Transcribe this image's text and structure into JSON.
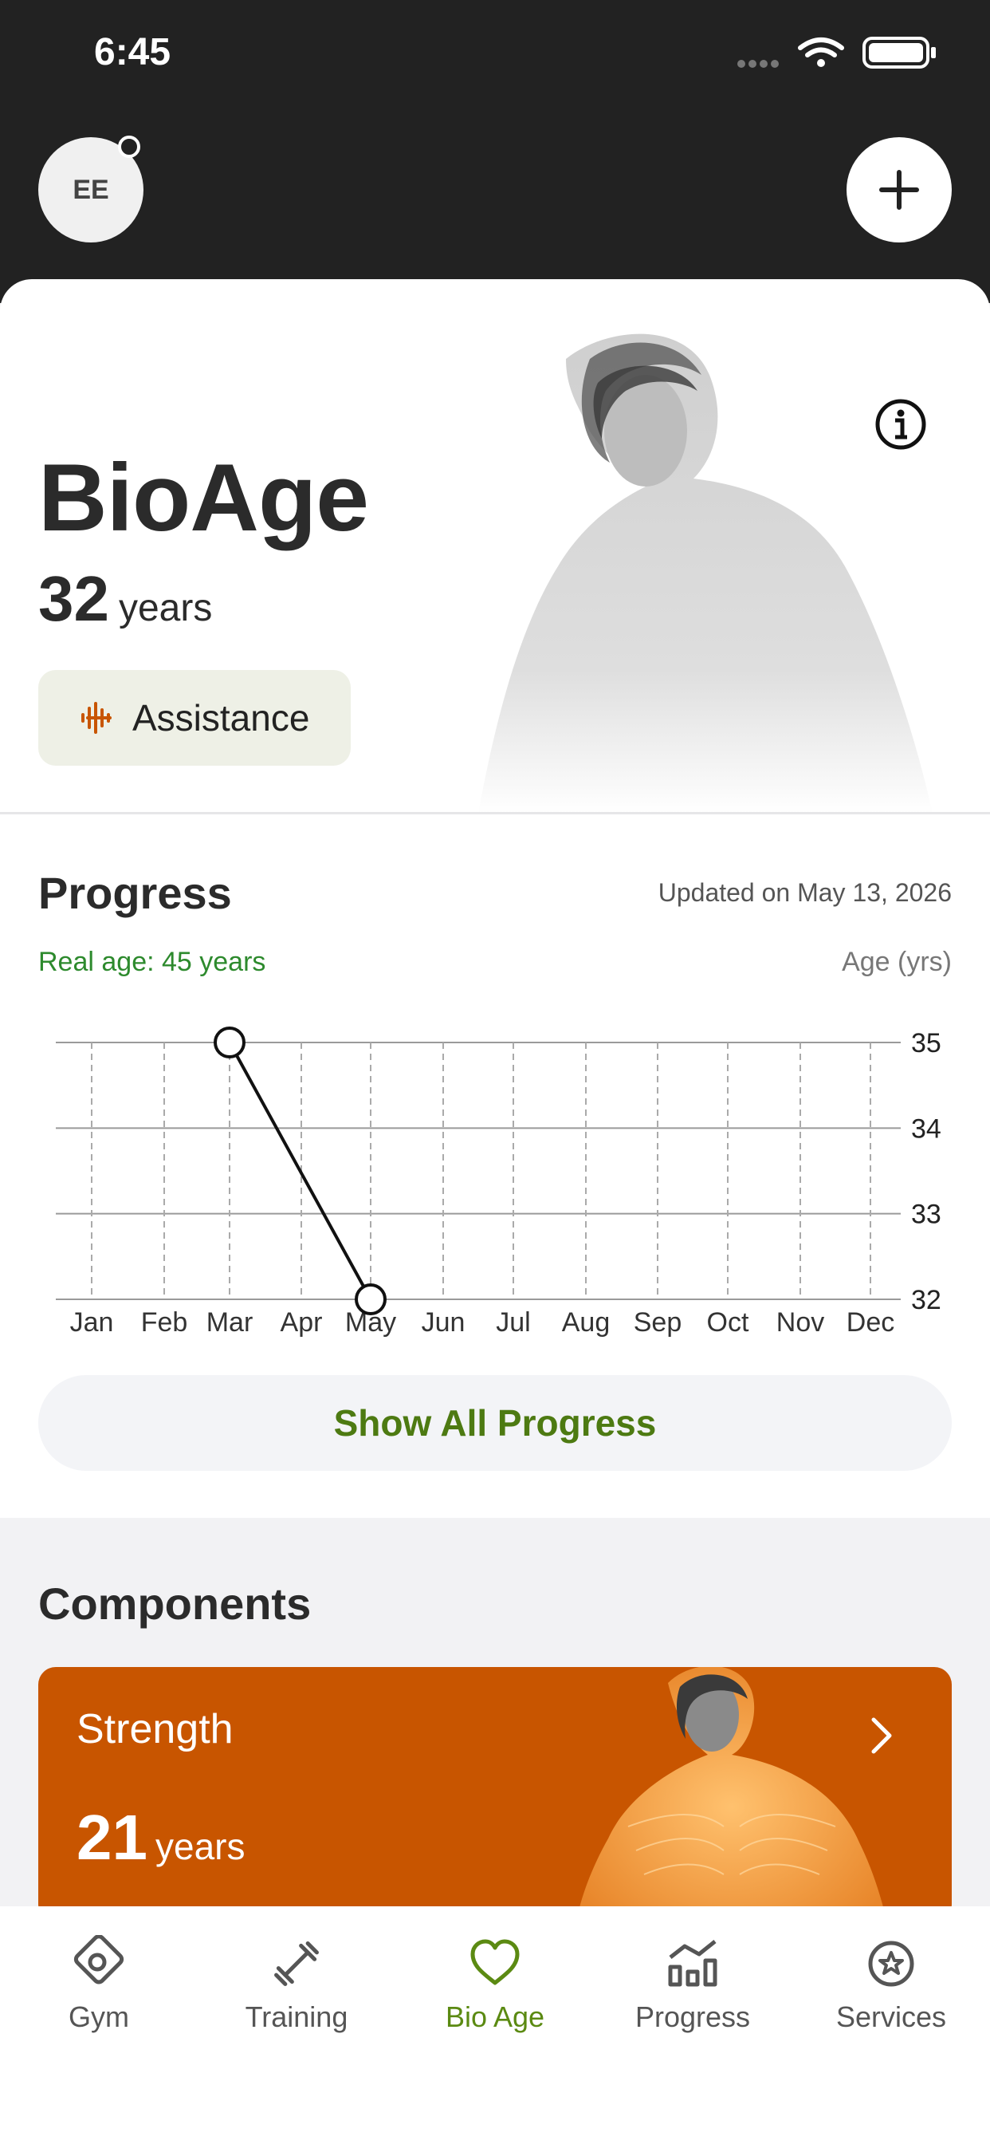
{
  "status_bar": {
    "time": "6:45"
  },
  "header": {
    "avatar_initials": "EE"
  },
  "hero": {
    "title": "BioAge",
    "age_value": "32",
    "age_unit": "years",
    "assistance_label": "Assistance"
  },
  "progress": {
    "title": "Progress",
    "updated": "Updated on May 13, 2026",
    "real_age": "Real age: 45 years",
    "axis_unit": "Age (yrs)",
    "show_all_label": "Show All Progress"
  },
  "chart_data": {
    "type": "line",
    "categories": [
      "Jan",
      "Feb",
      "Mar",
      "Apr",
      "May",
      "Jun",
      "Jul",
      "Aug",
      "Sep",
      "Oct",
      "Nov",
      "Dec"
    ],
    "series": [
      {
        "points": [
          {
            "x": "Mar",
            "y": 35
          },
          {
            "x": "May",
            "y": 32
          }
        ]
      }
    ],
    "yticks": [
      35,
      34,
      33,
      32
    ],
    "ylim": [
      32,
      35
    ],
    "y_axis_position": "right",
    "grid": true
  },
  "components": {
    "title": "Components",
    "strength": {
      "name": "Strength",
      "age_value": "21",
      "age_unit": "years"
    }
  },
  "tab_bar": {
    "items": [
      {
        "label": "Gym",
        "icon": "gym-icon"
      },
      {
        "label": "Training",
        "icon": "dumbbell-icon"
      },
      {
        "label": "Bio Age",
        "icon": "heart-icon",
        "active": true
      },
      {
        "label": "Progress",
        "icon": "progress-chart-icon"
      },
      {
        "label": "Services",
        "icon": "star-badge-icon"
      }
    ]
  },
  "colors": {
    "accent": "#5b8a12",
    "strength_card": "#c85500",
    "header_bg": "#222222",
    "real_age": "#2d8a2d"
  }
}
